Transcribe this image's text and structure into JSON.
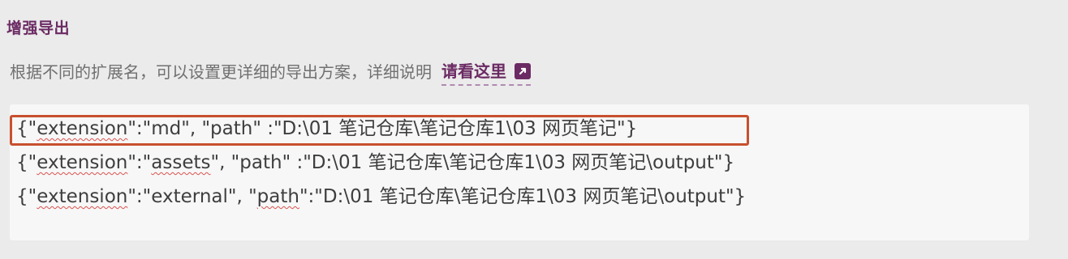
{
  "section": {
    "title": "增强导出"
  },
  "description": {
    "text": "根据不同的扩展名，可以设置更详细的导出方案，详细说明",
    "link_label": "请看这里",
    "link_icon": "external-link-icon"
  },
  "config": {
    "lines": [
      {
        "open": "{\"",
        "key": "extension",
        "mid": "\":\"md\", \"",
        "path_key": "path",
        "rest": "\" :\"D:\\01 笔记仓库\\笔记仓库1\\03 网页笔记\"}"
      },
      {
        "open": "{\"",
        "key": "extension",
        "mid": "\":\"",
        "value": "assets",
        "mid2": "\", \"",
        "path_key": "path",
        "rest": "\" :\"D:\\01 笔记仓库\\笔记仓库1\\03 网页笔记\\output\"}"
      },
      {
        "open": "{\"",
        "key": "extension",
        "mid": "\":\"external\", \"",
        "path_key": "path",
        "rest": "\":\"D:\\01 笔记仓库\\笔记仓库1\\03 网页笔记\\output\"}"
      }
    ]
  },
  "colors": {
    "accent": "#6b2a63",
    "highlight": "#c8502e",
    "spellcheck": "#d9534f"
  }
}
